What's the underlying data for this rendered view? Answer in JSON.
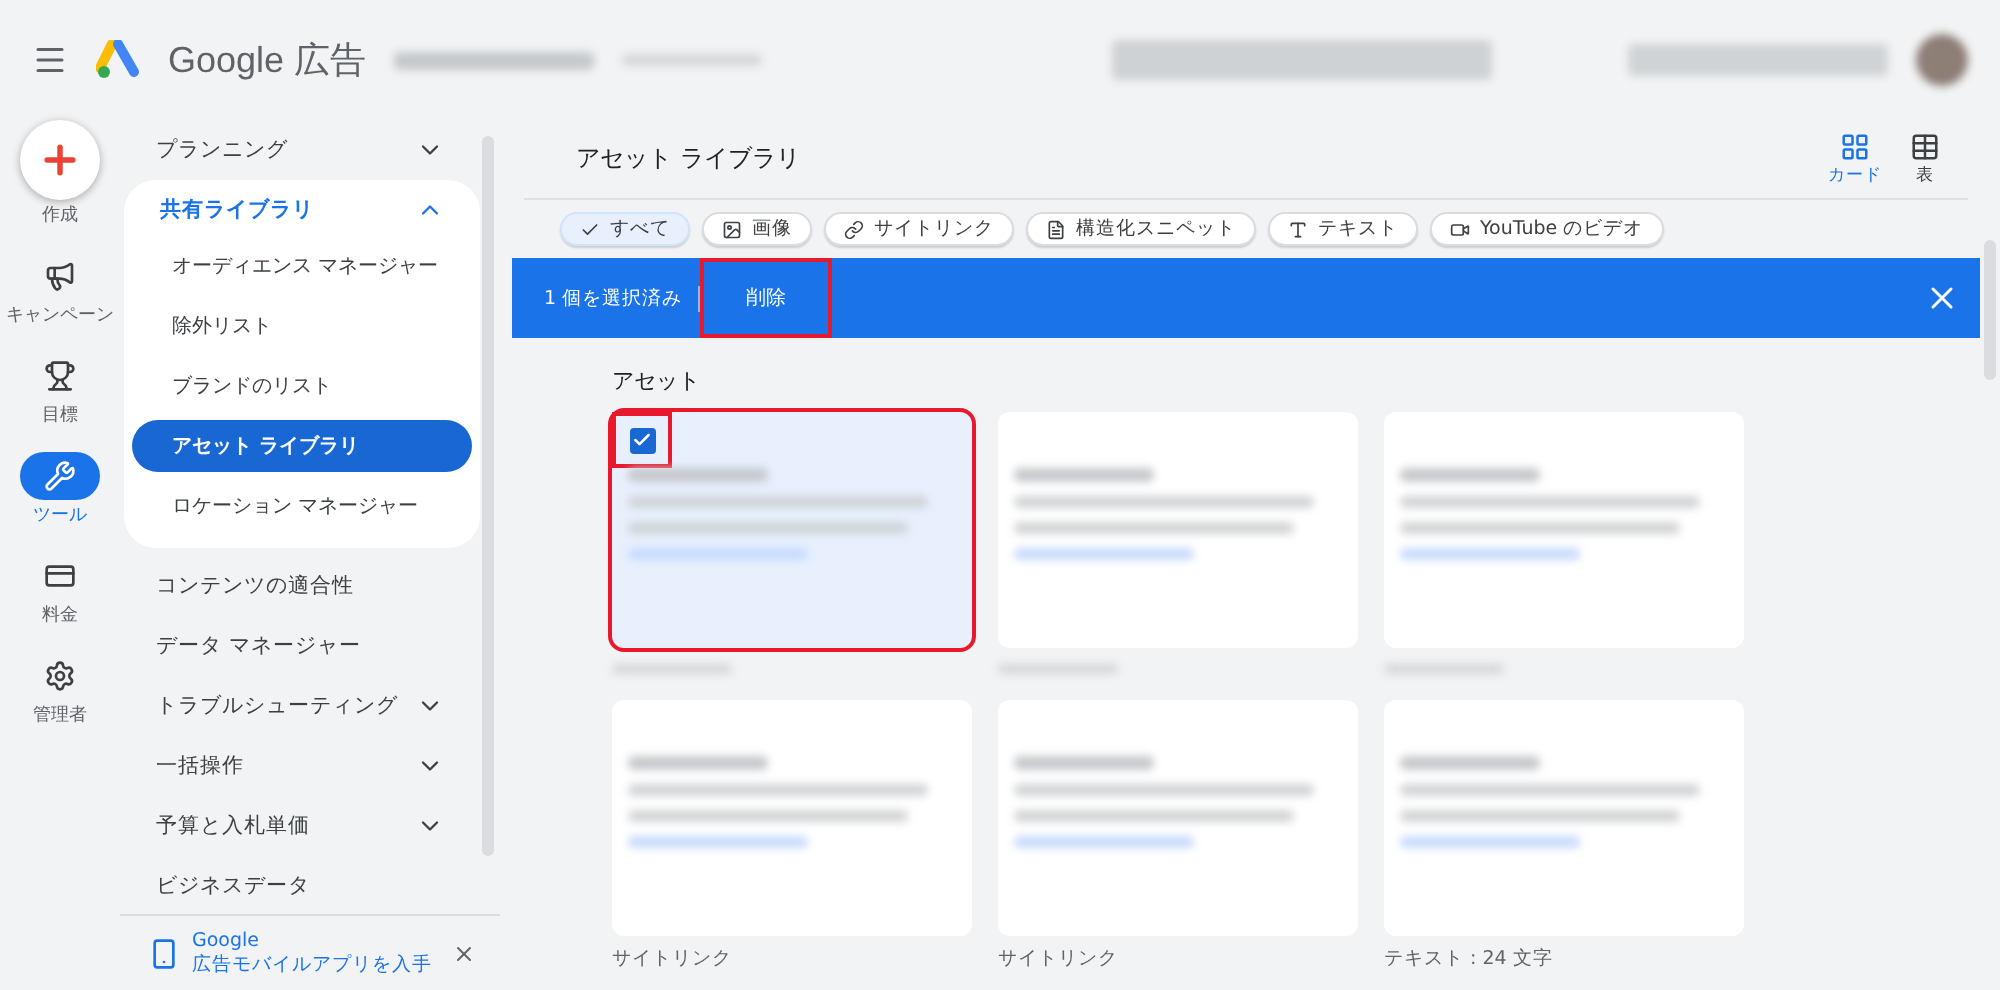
{
  "app_bar": {
    "brand": "Google 広告"
  },
  "rail": [
    {
      "label": "作成",
      "kind": "create",
      "selected": false
    },
    {
      "label": "キャンペーン",
      "kind": "megaphone",
      "selected": false
    },
    {
      "label": "目標",
      "kind": "trophy",
      "selected": false
    },
    {
      "label": "ツール",
      "kind": "tools",
      "selected": true
    },
    {
      "label": "料金",
      "kind": "billing",
      "selected": false
    },
    {
      "label": "管理者",
      "kind": "admin",
      "selected": false
    }
  ],
  "nav": [
    {
      "label": "プランニング",
      "expanded": false
    },
    {
      "label": "共有ライブラリ",
      "expanded": true,
      "children": [
        {
          "label": "オーディエンス マネージャー",
          "selected": false
        },
        {
          "label": "除外リスト",
          "selected": false
        },
        {
          "label": "ブランドのリスト",
          "selected": false
        },
        {
          "label": "アセット ライブラリ",
          "selected": true
        },
        {
          "label": "ロケーション マネージャー",
          "selected": false
        }
      ]
    },
    {
      "label": "コンテンツの適合性"
    },
    {
      "label": "データ マネージャー"
    },
    {
      "label": "トラブルシューティング",
      "expanded": false
    },
    {
      "label": "一括操作",
      "expanded": false
    },
    {
      "label": "予算と入札単価",
      "expanded": false
    },
    {
      "label": "ビジネスデータ"
    }
  ],
  "promo": {
    "line1": "Google",
    "line2": "広告モバイルアプリを入手"
  },
  "page": {
    "title": "アセット ライブラリ",
    "views": [
      {
        "label": "カード",
        "kind": "cards",
        "selected": true
      },
      {
        "label": "表",
        "kind": "table",
        "selected": false
      }
    ]
  },
  "filters": [
    {
      "label": "すべて",
      "kind": "check",
      "selected": true
    },
    {
      "label": "画像",
      "kind": "image",
      "selected": false
    },
    {
      "label": "サイトリンク",
      "kind": "link",
      "selected": false
    },
    {
      "label": "構造化スニペット",
      "kind": "doc",
      "selected": false
    },
    {
      "label": "テキスト",
      "kind": "text",
      "selected": false
    },
    {
      "label": "YouTube のビデオ",
      "kind": "video",
      "selected": false
    }
  ],
  "selection_bar": {
    "count": "1 個を選択済み",
    "action": "削除",
    "action_highlighted": true
  },
  "section_title": "アセット",
  "cards": [
    {
      "selected": true,
      "highlighted": true
    },
    {
      "selected": false,
      "highlighted": false
    },
    {
      "selected": false,
      "highlighted": false
    },
    {
      "selected": false,
      "highlighted": false,
      "caption": "サイトリンク"
    },
    {
      "selected": false,
      "highlighted": false,
      "caption": "サイトリンク"
    },
    {
      "selected": false,
      "highlighted": false,
      "caption": "テキスト : 24 文字"
    }
  ]
}
